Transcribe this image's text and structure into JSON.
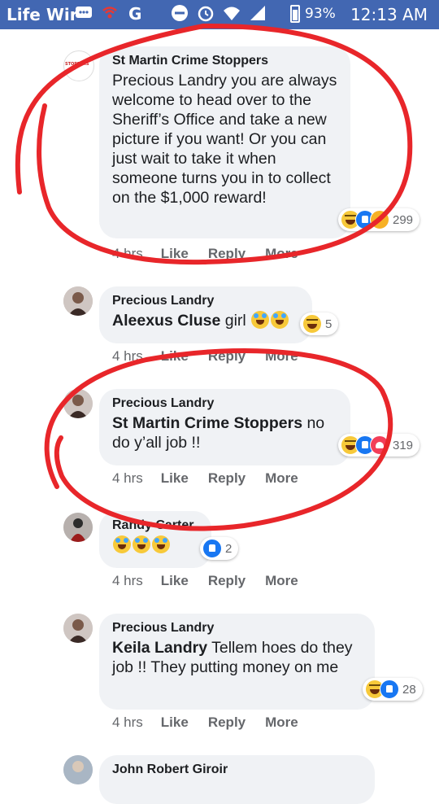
{
  "status_bar": {
    "carrier": "Life Wir",
    "battery": "93%",
    "time": "12:13 AM"
  },
  "comments": [
    {
      "author": "St Martin Crime Stoppers",
      "avatar_logo_text": "STOPPERS",
      "text_parts": [
        "Precious Landry you are always welcome to head over to the Sheriff’s Office and take a new picture if you want! Or you can just wait to take it when someone turns you in to collect on the $1,000 reward!"
      ],
      "reactions": [
        "haha",
        "like",
        "care"
      ],
      "reaction_count": "299",
      "time": "4 hrs",
      "like": "Like",
      "reply": "Reply",
      "more": "More"
    },
    {
      "author": "Precious Landry",
      "mention": "Aleexus Cluse",
      "text": " girl ",
      "reactions": [
        "haha"
      ],
      "reaction_count": "5",
      "time": "4 hrs",
      "like": "Like",
      "reply": "Reply",
      "more": "More"
    },
    {
      "author": "Precious Landry",
      "mention": "St Martin Crime Stoppers",
      "text": " no do y’all job !!",
      "reactions": [
        "haha",
        "like",
        "love"
      ],
      "reaction_count": "319",
      "time": "4 hrs",
      "like": "Like",
      "reply": "Reply",
      "more": "More"
    },
    {
      "author": "Randy Carter",
      "emoji_only": "😂😂😂",
      "reactions": [
        "like"
      ],
      "reaction_count": "2",
      "time": "4 hrs",
      "like": "Like",
      "reply": "Reply",
      "more": "More"
    },
    {
      "author": "Precious Landry",
      "mention": "Keila Landry",
      "text": " Tellem hoes do they job !! They putting money on me",
      "reactions": [
        "haha",
        "like"
      ],
      "reaction_count": "28",
      "time": "4 hrs",
      "like": "Like",
      "reply": "Reply",
      "more": "More"
    },
    {
      "author": "John Robert Giroir"
    }
  ]
}
